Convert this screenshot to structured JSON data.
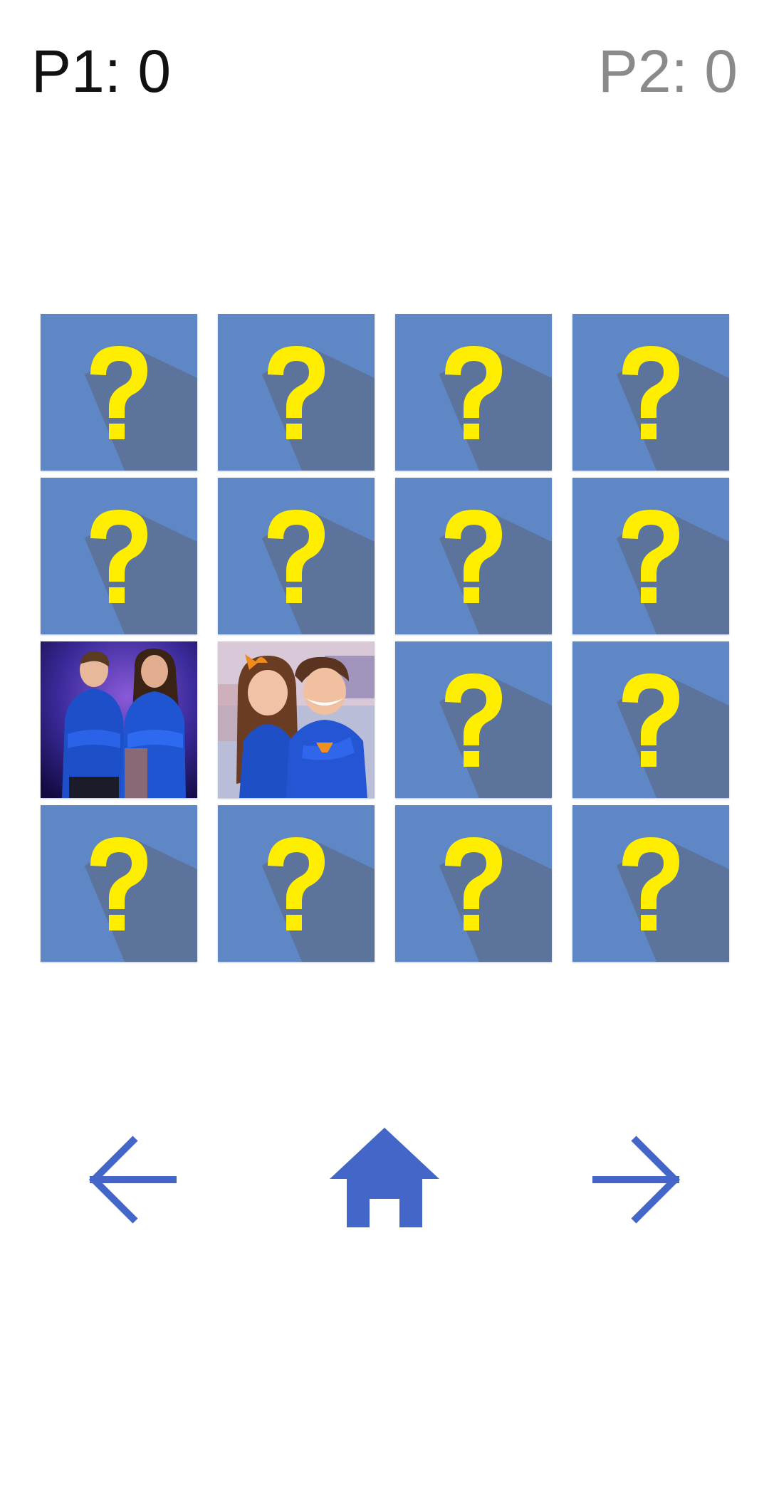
{
  "scoreboard": {
    "p1": {
      "label": "P1: 0",
      "color": "#111111",
      "active": true
    },
    "p2": {
      "label": "P2: 0",
      "color": "#8a8a8a",
      "active": false
    }
  },
  "colors": {
    "card_back": "#5f87c6",
    "card_shadow": "#5c7196",
    "question_mark": "#ffee00",
    "nav_icon": "#4466c8"
  },
  "board": {
    "rows": 4,
    "cols": 4,
    "cards": [
      {
        "state": "hidden"
      },
      {
        "state": "hidden"
      },
      {
        "state": "hidden"
      },
      {
        "state": "hidden"
      },
      {
        "state": "hidden"
      },
      {
        "state": "hidden"
      },
      {
        "state": "hidden"
      },
      {
        "state": "hidden"
      },
      {
        "state": "revealed",
        "image": "duo-superhero-portrait"
      },
      {
        "state": "revealed",
        "image": "kids-superhero-portrait"
      },
      {
        "state": "hidden"
      },
      {
        "state": "hidden"
      },
      {
        "state": "hidden"
      },
      {
        "state": "hidden"
      },
      {
        "state": "hidden"
      },
      {
        "state": "hidden"
      }
    ]
  },
  "nav": {
    "back_icon": "arrow-left-icon",
    "home_icon": "home-icon",
    "forward_icon": "arrow-right-icon"
  }
}
